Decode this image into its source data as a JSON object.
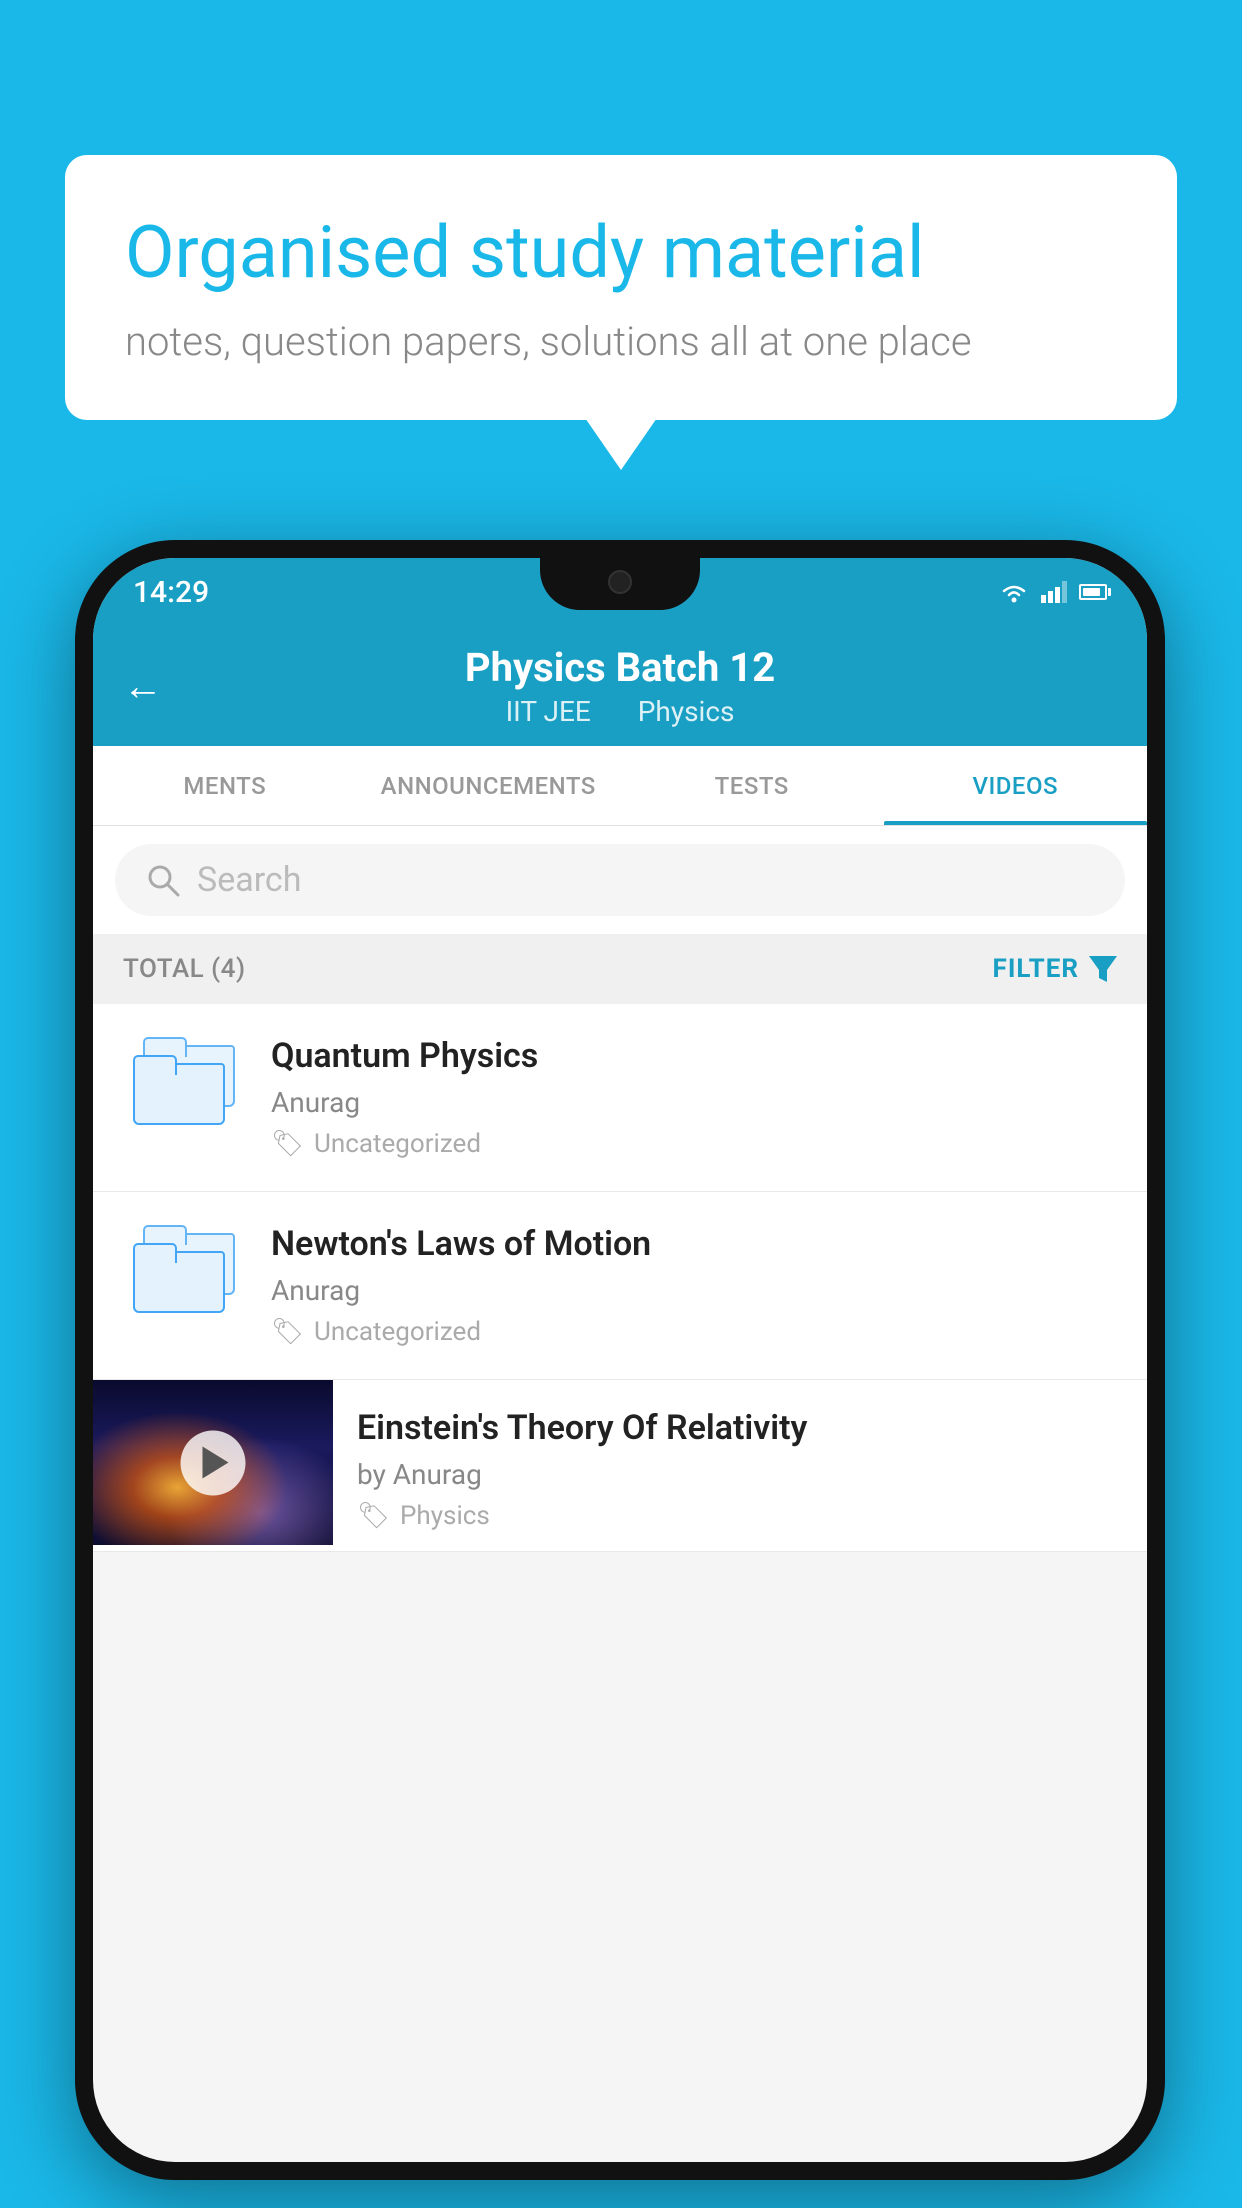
{
  "app": {
    "background_color": "#1ab8e8"
  },
  "bubble": {
    "title": "Organised study material",
    "subtitle": "notes, question papers, solutions all at one place"
  },
  "status_bar": {
    "time": "14:29"
  },
  "app_bar": {
    "title": "Physics Batch 12",
    "subtitle_part1": "IIT JEE",
    "subtitle_part2": "Physics",
    "back_label": "←"
  },
  "tabs": [
    {
      "label": "MENTS",
      "active": false
    },
    {
      "label": "ANNOUNCEMENTS",
      "active": false
    },
    {
      "label": "TESTS",
      "active": false
    },
    {
      "label": "VIDEOS",
      "active": true
    }
  ],
  "search": {
    "placeholder": "Search"
  },
  "filter_row": {
    "total_label": "TOTAL (4)",
    "filter_label": "FILTER"
  },
  "videos": [
    {
      "title": "Quantum Physics",
      "author": "Anurag",
      "tag": "Uncategorized",
      "type": "folder"
    },
    {
      "title": "Newton's Laws of Motion",
      "author": "Anurag",
      "tag": "Uncategorized",
      "type": "folder"
    },
    {
      "title": "Einstein's Theory Of Relativity",
      "author": "by Anurag",
      "tag": "Physics",
      "type": "video"
    }
  ]
}
